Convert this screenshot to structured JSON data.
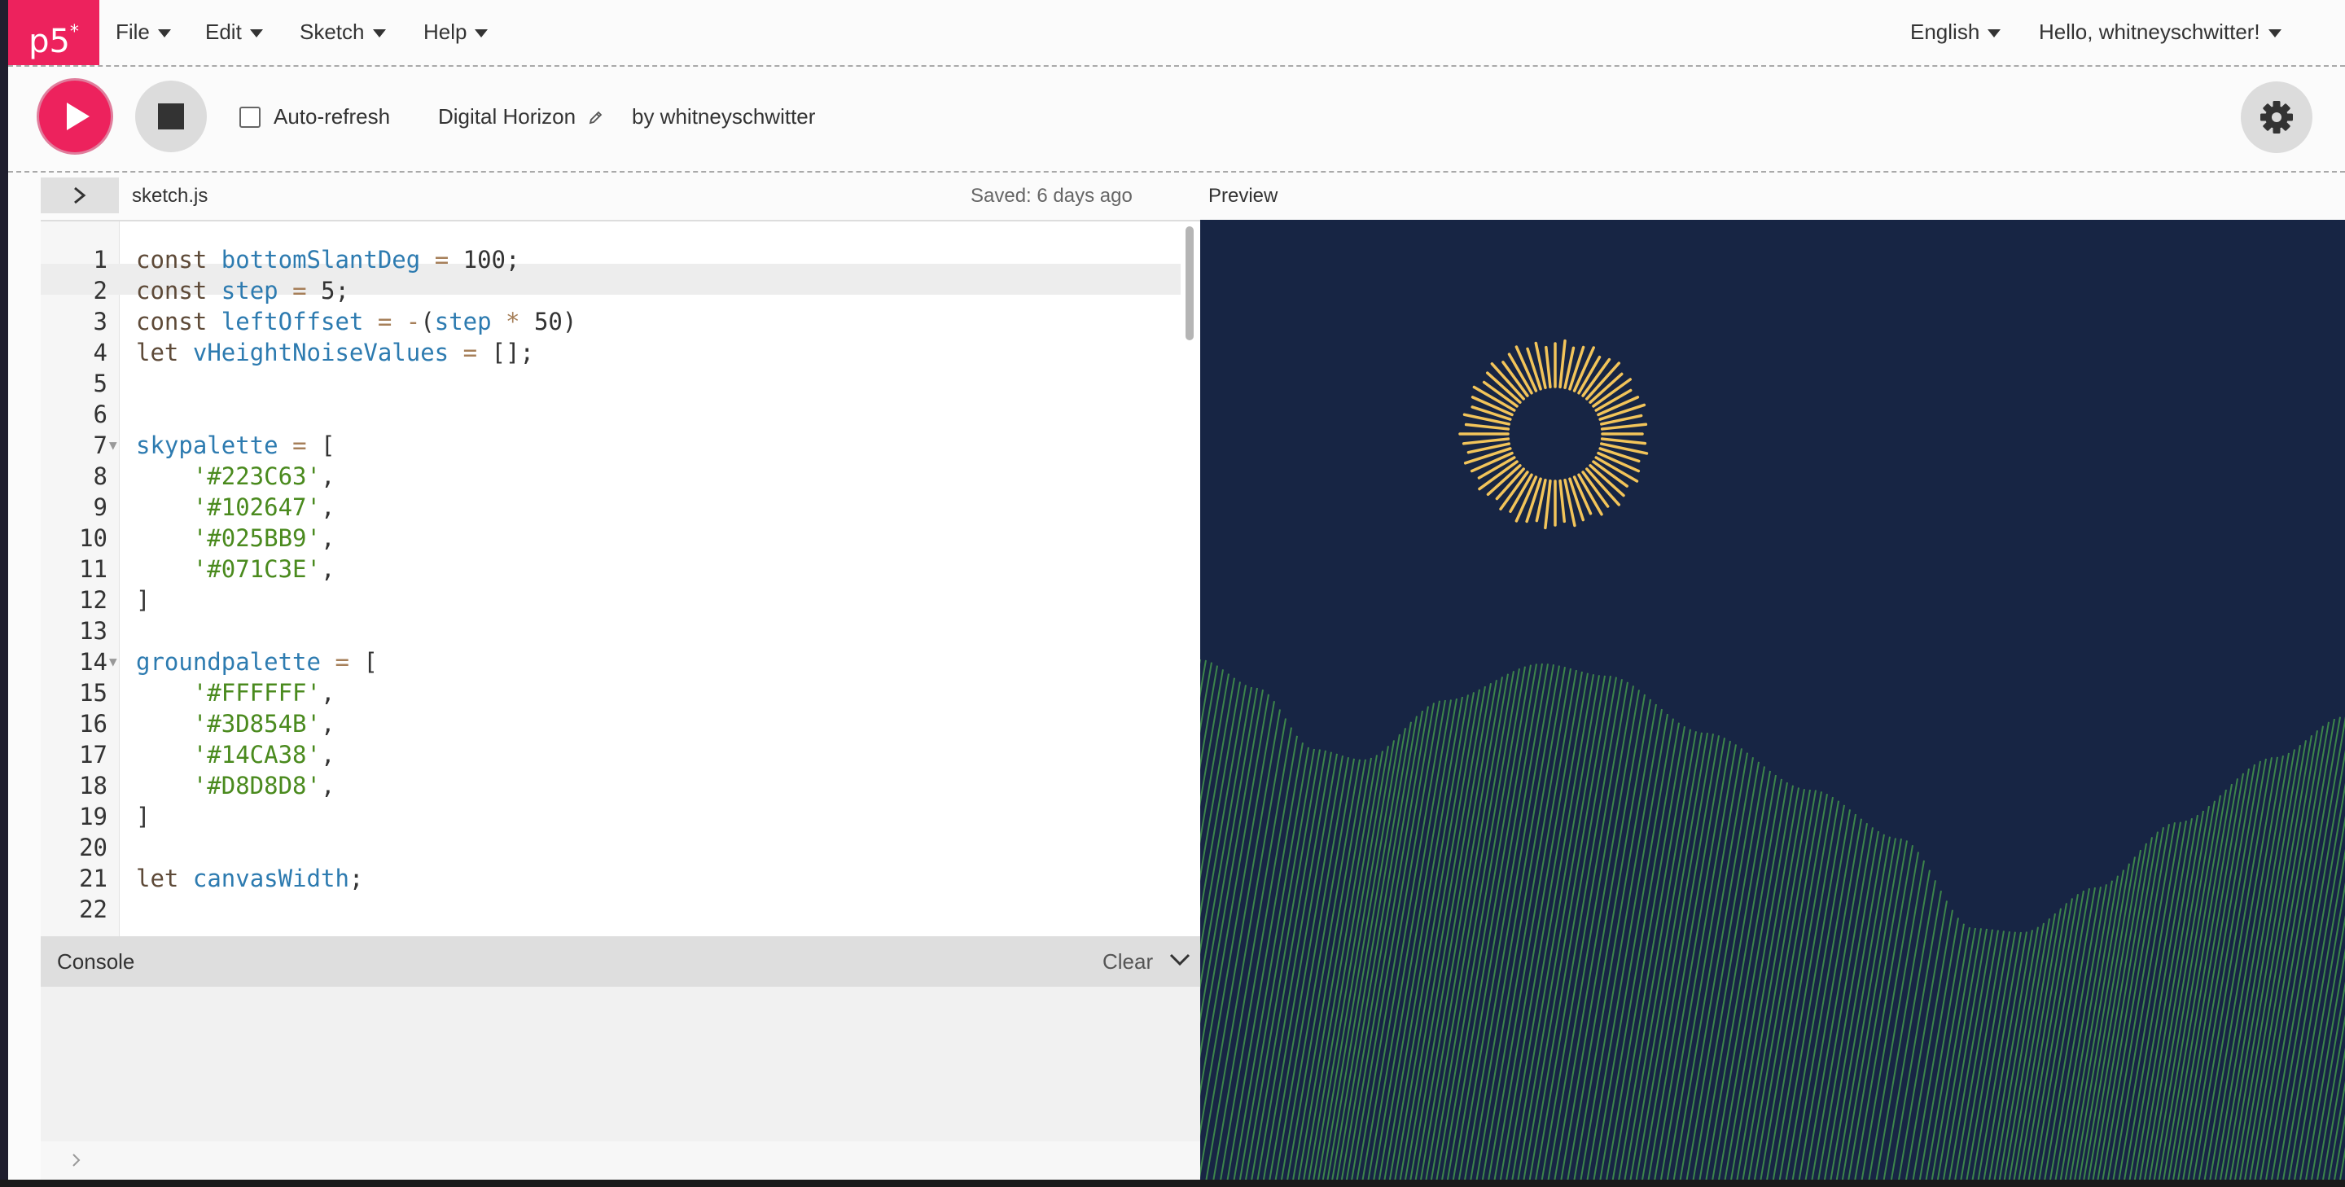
{
  "app": {
    "logo": "p5",
    "logo_sup": "*"
  },
  "nav": {
    "menus": [
      {
        "label": "File"
      },
      {
        "label": "Edit"
      },
      {
        "label": "Sketch"
      },
      {
        "label": "Help"
      }
    ],
    "language": "English",
    "user_greeting": "Hello, whitneyschwitter!"
  },
  "toolbar": {
    "auto_refresh_label": "Auto-refresh",
    "auto_refresh_checked": false,
    "sketch_name": "Digital Horizon",
    "sketch_owner": "by whitneyschwitter"
  },
  "editor": {
    "file_name": "sketch.js",
    "saved_status": "Saved: 6 days ago",
    "active_line": 1,
    "lines": [
      {
        "n": "1",
        "text": "const bottomSlantDeg = 100;"
      },
      {
        "n": "2",
        "text": "const step = 5;"
      },
      {
        "n": "3",
        "text": "const leftOffset = -(step * 50)"
      },
      {
        "n": "4",
        "text": "let vHeightNoiseValues = [];"
      },
      {
        "n": "5",
        "text": ""
      },
      {
        "n": "6",
        "text": ""
      },
      {
        "n": "7",
        "text": "skypalette = [",
        "fold": true
      },
      {
        "n": "8",
        "text": "    '#223C63',"
      },
      {
        "n": "9",
        "text": "    '#102647',"
      },
      {
        "n": "10",
        "text": "    '#025BB9',"
      },
      {
        "n": "11",
        "text": "    '#071C3E',"
      },
      {
        "n": "12",
        "text": "]"
      },
      {
        "n": "13",
        "text": ""
      },
      {
        "n": "14",
        "text": "groundpalette = [",
        "fold": true
      },
      {
        "n": "15",
        "text": "    '#FFFFFF',"
      },
      {
        "n": "16",
        "text": "    '#3D854B',"
      },
      {
        "n": "17",
        "text": "    '#14CA38',"
      },
      {
        "n": "18",
        "text": "    '#D8D8D8',"
      },
      {
        "n": "19",
        "text": "]"
      },
      {
        "n": "20",
        "text": ""
      },
      {
        "n": "21",
        "text": "let canvasWidth;"
      },
      {
        "n": "22",
        "text": ""
      }
    ]
  },
  "console": {
    "title": "Console",
    "clear_label": "Clear"
  },
  "preview": {
    "label": "Preview",
    "sky_color": "#223C63",
    "sun_color": "#F2C45A",
    "ground_color": "#3D854B"
  },
  "colors": {
    "accent": "#ED225D"
  }
}
